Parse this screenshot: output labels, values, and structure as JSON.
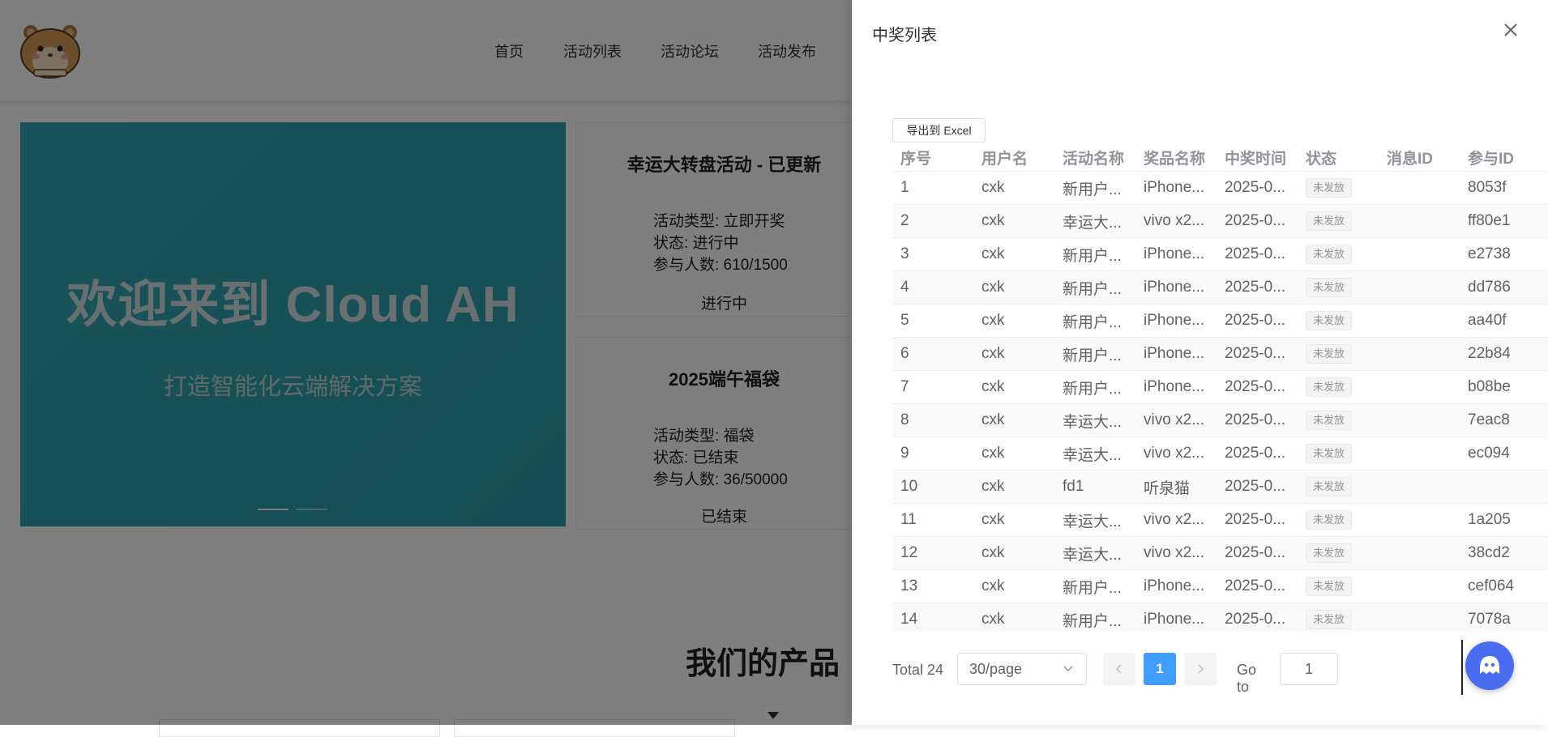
{
  "nav": {
    "items": [
      {
        "label": "首页"
      },
      {
        "label": "活动列表"
      },
      {
        "label": "活动论坛"
      },
      {
        "label": "活动发布"
      }
    ]
  },
  "banner": {
    "title": "欢迎来到 Cloud AH",
    "subtitle": "打造智能化云端解决方案"
  },
  "cards": [
    {
      "title": "幸运大转盘活动 - 已更新",
      "type_line": "活动类型: 立即开奖",
      "status_line": "状态: 进行中",
      "count_line": "参与人数: 610/1500",
      "status": "进行中"
    },
    {
      "title": "2025端午福袋",
      "type_line": "活动类型: 福袋",
      "status_line": "状态: 已结束",
      "count_line": "参与人数: 36/50000",
      "status": "已结束"
    }
  ],
  "products": {
    "title": "我们的产品"
  },
  "drawer": {
    "title": "中奖列表",
    "export_label": "导出到 Excel",
    "columns": [
      "序号",
      "用户名",
      "活动名称",
      "奖品名称",
      "中奖时间",
      "状态",
      "消息ID",
      "参与ID"
    ],
    "rows": [
      {
        "idx": "1",
        "user": "cxk",
        "activity": "新用户...",
        "prize": "iPhone...",
        "time": "2025-0...",
        "status": "未发放",
        "msg": "",
        "pid": "8053f"
      },
      {
        "idx": "2",
        "user": "cxk",
        "activity": "幸运大...",
        "prize": "vivo x2...",
        "time": "2025-0...",
        "status": "未发放",
        "msg": "",
        "pid": "ff80e1"
      },
      {
        "idx": "3",
        "user": "cxk",
        "activity": "新用户...",
        "prize": "iPhone...",
        "time": "2025-0...",
        "status": "未发放",
        "msg": "",
        "pid": "e2738"
      },
      {
        "idx": "4",
        "user": "cxk",
        "activity": "新用户...",
        "prize": "iPhone...",
        "time": "2025-0...",
        "status": "未发放",
        "msg": "",
        "pid": "dd786"
      },
      {
        "idx": "5",
        "user": "cxk",
        "activity": "新用户...",
        "prize": "iPhone...",
        "time": "2025-0...",
        "status": "未发放",
        "msg": "",
        "pid": "aa40f"
      },
      {
        "idx": "6",
        "user": "cxk",
        "activity": "新用户...",
        "prize": "iPhone...",
        "time": "2025-0...",
        "status": "未发放",
        "msg": "",
        "pid": "22b84"
      },
      {
        "idx": "7",
        "user": "cxk",
        "activity": "新用户...",
        "prize": "iPhone...",
        "time": "2025-0...",
        "status": "未发放",
        "msg": "",
        "pid": "b08be"
      },
      {
        "idx": "8",
        "user": "cxk",
        "activity": "幸运大...",
        "prize": "vivo x2...",
        "time": "2025-0...",
        "status": "未发放",
        "msg": "",
        "pid": "7eac8"
      },
      {
        "idx": "9",
        "user": "cxk",
        "activity": "幸运大...",
        "prize": "vivo x2...",
        "time": "2025-0...",
        "status": "未发放",
        "msg": "",
        "pid": "ec094"
      },
      {
        "idx": "10",
        "user": "cxk",
        "activity": "fd1",
        "prize": "听泉猫",
        "time": "2025-0...",
        "status": "未发放",
        "msg": "",
        "pid": ""
      },
      {
        "idx": "11",
        "user": "cxk",
        "activity": "幸运大...",
        "prize": "vivo x2...",
        "time": "2025-0...",
        "status": "未发放",
        "msg": "",
        "pid": "1a205"
      },
      {
        "idx": "12",
        "user": "cxk",
        "activity": "幸运大...",
        "prize": "vivo x2...",
        "time": "2025-0...",
        "status": "未发放",
        "msg": "",
        "pid": "38cd2"
      },
      {
        "idx": "13",
        "user": "cxk",
        "activity": "新用户...",
        "prize": "iPhone...",
        "time": "2025-0...",
        "status": "未发放",
        "msg": "",
        "pid": "cef064"
      },
      {
        "idx": "14",
        "user": "cxk",
        "activity": "新用户...",
        "prize": "iPhone...",
        "time": "2025-0...",
        "status": "未发放",
        "msg": "",
        "pid": "7078a"
      }
    ]
  },
  "pagination": {
    "total": "Total 24",
    "page_size": "30/page",
    "prev_icon": "chevron-left-icon",
    "current_page": "1",
    "next_icon": "chevron-right-icon",
    "goto_label": "Go to",
    "goto_value": "1"
  },
  "colors": {
    "accent": "#409eff",
    "banner": "#35a7b6",
    "chat_button": "#4a6df0"
  }
}
